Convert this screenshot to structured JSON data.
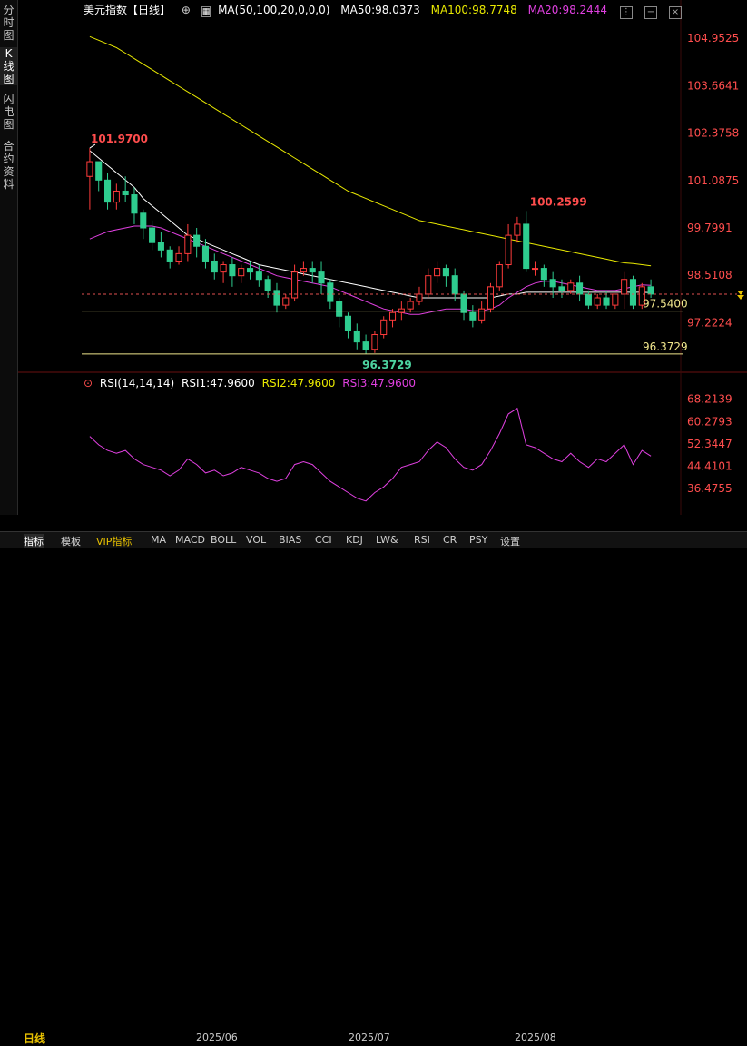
{
  "sidebar": {
    "tabs": [
      {
        "label": "分时图",
        "active": false
      },
      {
        "label": "K线图",
        "active": true
      },
      {
        "label": "闪电图",
        "active": false
      },
      {
        "label": "合约资料",
        "active": false
      }
    ]
  },
  "header": {
    "title": "美元指数【日线】",
    "ma_params": "MA(50,100,20,0,0,0)",
    "ma50": "MA50:98.0373",
    "ma100": "MA100:98.7748",
    "ma20": "MA20:98.2444"
  },
  "price_axis": {
    "ticks": [
      "104.9525",
      "103.6641",
      "102.3758",
      "101.0875",
      "99.7991",
      "98.5108",
      "97.2224"
    ]
  },
  "annotations": {
    "high1": "101.9700",
    "high2": "100.2599",
    "low": "96.3729",
    "support1": "97.5400",
    "support2": "96.3729"
  },
  "rsi": {
    "params": "RSI(14,14,14)",
    "rsi1": "RSI1:47.9600",
    "rsi2": "RSI2:47.9600",
    "rsi3": "RSI3:47.9600",
    "ticks": [
      "68.2139",
      "60.2793",
      "52.3447",
      "44.4101",
      "36.4755"
    ]
  },
  "date_axis": {
    "period": "日线",
    "labels": [
      "2025/06",
      "2025/07",
      "2025/08"
    ]
  },
  "bottom_tabs": [
    "指标",
    "模板",
    "VIP指标",
    "MA",
    "MACD",
    "BOLL",
    "VOL",
    "BIAS",
    "CCI",
    "KDJ",
    "LW&",
    "RSI",
    "CR",
    "PSY",
    "设置"
  ],
  "colors": {
    "up": "#ff3b3b",
    "down": "#2ecc8f",
    "ma50": "#ffffff",
    "ma100": "#e8e800",
    "ma20": "#e040e0",
    "axis_text": "#ff4d4d"
  },
  "chart_data": {
    "type": "candlestick",
    "price_range": [
      96.0,
      105.5
    ],
    "rsi_range": [
      30,
      72
    ],
    "candles": [
      [
        101.2,
        101.97,
        101.6,
        100.3
      ],
      [
        101.6,
        101.6,
        101.1,
        100.8
      ],
      [
        101.1,
        101.3,
        100.5,
        100.3
      ],
      [
        100.5,
        101.0,
        100.8,
        100.3
      ],
      [
        100.8,
        101.2,
        100.7,
        100.5
      ],
      [
        100.7,
        100.9,
        100.2,
        99.9
      ],
      [
        100.2,
        100.3,
        99.8,
        99.5
      ],
      [
        99.8,
        100.0,
        99.4,
        99.2
      ],
      [
        99.4,
        99.7,
        99.2,
        99.0
      ],
      [
        99.2,
        99.3,
        98.9,
        98.7
      ],
      [
        98.9,
        99.3,
        99.1,
        98.8
      ],
      [
        99.1,
        99.9,
        99.6,
        98.9
      ],
      [
        99.6,
        99.8,
        99.3,
        99.0
      ],
      [
        99.3,
        99.5,
        98.9,
        98.7
      ],
      [
        98.9,
        99.1,
        98.6,
        98.4
      ],
      [
        98.6,
        98.9,
        98.8,
        98.3
      ],
      [
        98.8,
        99.0,
        98.5,
        98.2
      ],
      [
        98.5,
        98.8,
        98.7,
        98.3
      ],
      [
        98.7,
        98.9,
        98.6,
        98.4
      ],
      [
        98.6,
        98.8,
        98.4,
        98.2
      ],
      [
        98.4,
        98.5,
        98.1,
        97.9
      ],
      [
        98.1,
        98.3,
        97.7,
        97.5
      ],
      [
        97.7,
        98.0,
        97.9,
        97.6
      ],
      [
        97.9,
        98.8,
        98.6,
        97.8
      ],
      [
        98.6,
        98.9,
        98.7,
        98.5
      ],
      [
        98.7,
        98.9,
        98.6,
        98.3
      ],
      [
        98.6,
        98.9,
        98.3,
        98.0
      ],
      [
        98.3,
        98.4,
        97.8,
        97.6
      ],
      [
        97.8,
        97.9,
        97.4,
        97.1
      ],
      [
        97.4,
        97.5,
        97.0,
        96.8
      ],
      [
        97.0,
        97.2,
        96.7,
        96.5
      ],
      [
        96.7,
        96.9,
        96.5,
        96.37
      ],
      [
        96.5,
        97.0,
        96.9,
        96.4
      ],
      [
        96.9,
        97.4,
        97.3,
        96.8
      ],
      [
        97.3,
        97.6,
        97.5,
        97.1
      ],
      [
        97.5,
        97.8,
        97.6,
        97.3
      ],
      [
        97.6,
        97.9,
        97.8,
        97.5
      ],
      [
        97.8,
        98.2,
        98.0,
        97.7
      ],
      [
        98.0,
        98.7,
        98.5,
        97.9
      ],
      [
        98.5,
        98.9,
        98.7,
        98.3
      ],
      [
        98.7,
        98.8,
        98.5,
        98.2
      ],
      [
        98.5,
        98.7,
        98.0,
        97.8
      ],
      [
        98.0,
        98.1,
        97.5,
        97.3
      ],
      [
        97.5,
        97.7,
        97.3,
        97.1
      ],
      [
        97.3,
        97.8,
        97.6,
        97.2
      ],
      [
        97.6,
        98.3,
        98.2,
        97.5
      ],
      [
        98.2,
        98.9,
        98.8,
        98.1
      ],
      [
        98.8,
        99.9,
        99.6,
        98.7
      ],
      [
        99.6,
        100.1,
        99.9,
        99.4
      ],
      [
        99.9,
        100.26,
        98.7,
        98.6
      ],
      [
        98.7,
        98.9,
        98.7,
        98.5
      ],
      [
        98.7,
        98.8,
        98.4,
        98.2
      ],
      [
        98.4,
        98.6,
        98.2,
        97.9
      ],
      [
        98.2,
        98.4,
        98.1,
        97.9
      ],
      [
        98.1,
        98.4,
        98.3,
        98.0
      ],
      [
        98.3,
        98.5,
        98.0,
        97.8
      ],
      [
        98.0,
        98.1,
        97.7,
        97.6
      ],
      [
        97.7,
        98.0,
        97.9,
        97.6
      ],
      [
        97.9,
        98.1,
        97.7,
        97.6
      ],
      [
        97.7,
        98.0,
        98.0,
        97.6
      ],
      [
        98.0,
        98.6,
        98.4,
        97.6
      ],
      [
        98.4,
        98.5,
        97.7,
        97.6
      ],
      [
        97.7,
        98.3,
        98.2,
        97.6
      ],
      [
        98.2,
        98.4,
        98.0,
        97.9
      ]
    ],
    "ma50": [
      101.9,
      101.7,
      101.5,
      101.3,
      101.1,
      100.9,
      100.6,
      100.4,
      100.2,
      100.0,
      99.8,
      99.6,
      99.5,
      99.4,
      99.3,
      99.2,
      99.1,
      99.0,
      98.9,
      98.8,
      98.75,
      98.7,
      98.65,
      98.6,
      98.55,
      98.5,
      98.45,
      98.4,
      98.35,
      98.3,
      98.25,
      98.2,
      98.15,
      98.1,
      98.05,
      98.0,
      97.95,
      97.9,
      97.9,
      97.9,
      97.9,
      97.9,
      97.9,
      97.9,
      97.9,
      97.9,
      97.95,
      98.0,
      98.0,
      98.05,
      98.05,
      98.05,
      98.05,
      98.05,
      98.05,
      98.05,
      98.05,
      98.05,
      98.05,
      98.05,
      98.05,
      98.05,
      98.05,
      98.04
    ],
    "ma100": [
      105.0,
      104.9,
      104.8,
      104.7,
      104.55,
      104.4,
      104.25,
      104.1,
      103.95,
      103.8,
      103.65,
      103.5,
      103.35,
      103.2,
      103.05,
      102.9,
      102.75,
      102.6,
      102.45,
      102.3,
      102.15,
      102.0,
      101.85,
      101.7,
      101.55,
      101.4,
      101.25,
      101.1,
      100.95,
      100.8,
      100.7,
      100.6,
      100.5,
      100.4,
      100.3,
      100.2,
      100.1,
      100.0,
      99.95,
      99.9,
      99.85,
      99.8,
      99.75,
      99.7,
      99.65,
      99.6,
      99.55,
      99.5,
      99.45,
      99.4,
      99.35,
      99.3,
      99.25,
      99.2,
      99.15,
      99.1,
      99.05,
      99.0,
      98.95,
      98.9,
      98.85,
      98.83,
      98.8,
      98.77
    ],
    "ma20": [
      99.5,
      99.6,
      99.7,
      99.75,
      99.8,
      99.85,
      99.85,
      99.85,
      99.8,
      99.7,
      99.6,
      99.5,
      99.4,
      99.3,
      99.2,
      99.1,
      99.0,
      98.9,
      98.8,
      98.7,
      98.6,
      98.5,
      98.45,
      98.4,
      98.35,
      98.3,
      98.25,
      98.2,
      98.1,
      98.0,
      97.9,
      97.8,
      97.7,
      97.6,
      97.55,
      97.5,
      97.45,
      97.45,
      97.5,
      97.55,
      97.6,
      97.6,
      97.6,
      97.55,
      97.55,
      97.6,
      97.7,
      97.9,
      98.05,
      98.2,
      98.3,
      98.35,
      98.35,
      98.3,
      98.25,
      98.2,
      98.15,
      98.1,
      98.1,
      98.1,
      98.15,
      98.2,
      98.25,
      98.24
    ],
    "rsi": [
      55,
      52,
      50,
      49,
      50,
      47,
      45,
      44,
      43,
      41,
      43,
      47,
      45,
      42,
      43,
      41,
      42,
      44,
      43,
      42,
      40,
      39,
      40,
      45,
      46,
      45,
      42,
      39,
      37,
      35,
      33,
      32,
      35,
      37,
      40,
      44,
      45,
      46,
      50,
      53,
      51,
      47,
      44,
      43,
      45,
      50,
      56,
      63,
      65,
      52,
      51,
      49,
      47,
      46,
      49,
      46,
      44,
      47,
      46,
      49,
      52,
      45,
      50,
      48
    ]
  }
}
